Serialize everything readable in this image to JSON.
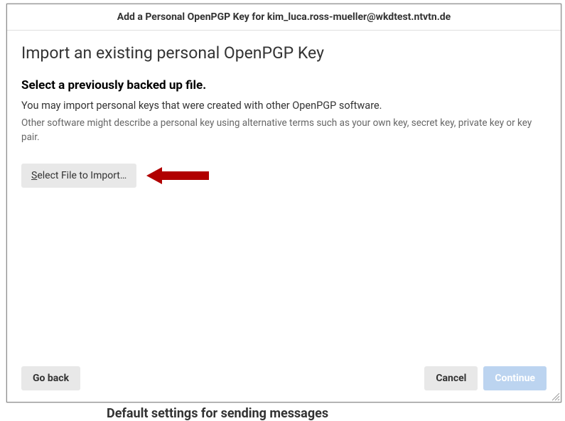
{
  "background": {
    "text_heading_bottom": "Default settings for sending messages"
  },
  "dialog": {
    "title": "Add a Personal OpenPGP Key for kim_luca.ross-mueller@wkdtest.ntvtn.de",
    "heading": "Import an existing personal OpenPGP Key",
    "subheading": "Select a previously backed up file.",
    "body_text": "You may import personal keys that were created with other OpenPGP software.",
    "hint_text": "Other software might describe a personal key using alternative terms such as your own key, secret key, private key or key pair.",
    "select_button_prefix": "S",
    "select_button_rest": "elect File to Import…",
    "go_back": "Go back",
    "cancel": "Cancel",
    "continue": "Continue"
  }
}
